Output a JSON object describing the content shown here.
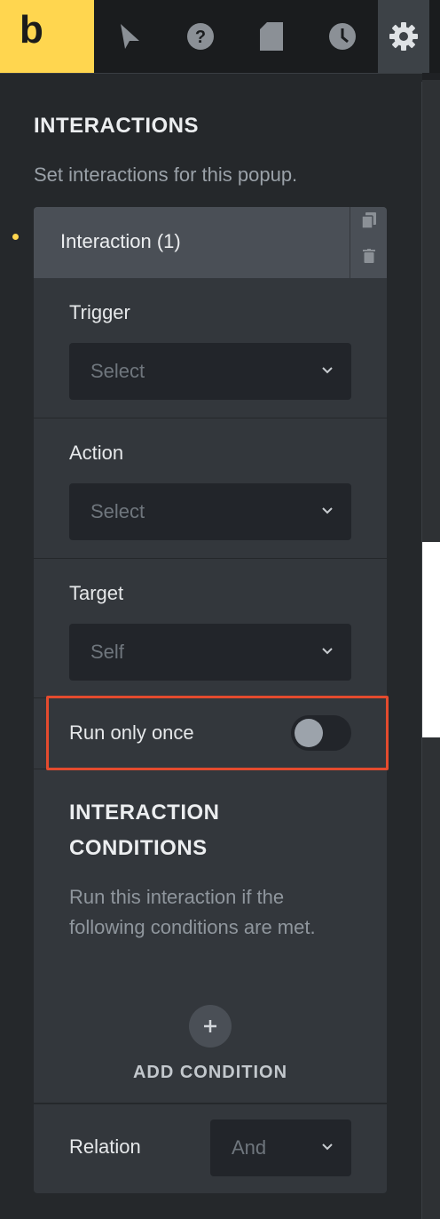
{
  "toolbar": {
    "logo_letter": "b",
    "icons": [
      "cursor-icon",
      "help-icon",
      "page-icon",
      "history-icon",
      "settings-icon"
    ]
  },
  "section": {
    "title": "INTERACTIONS",
    "description": "Set interactions for this popup."
  },
  "interaction": {
    "title": "Interaction (1)",
    "trigger": {
      "label": "Trigger",
      "value": "Select"
    },
    "action": {
      "label": "Action",
      "value": "Select"
    },
    "target": {
      "label": "Target",
      "value": "Self"
    },
    "run_once": {
      "label": "Run only once",
      "enabled": false
    },
    "conditions": {
      "title": "INTERACTION CONDITIONS",
      "description": "Run this interaction if the following conditions are met.",
      "add_label": "ADD CONDITION"
    },
    "relation": {
      "label": "Relation",
      "value": "And"
    }
  },
  "colors": {
    "brand": "#ffd64f",
    "highlight": "#e44b2e",
    "panel": "#25282b",
    "card": "#33373c"
  }
}
